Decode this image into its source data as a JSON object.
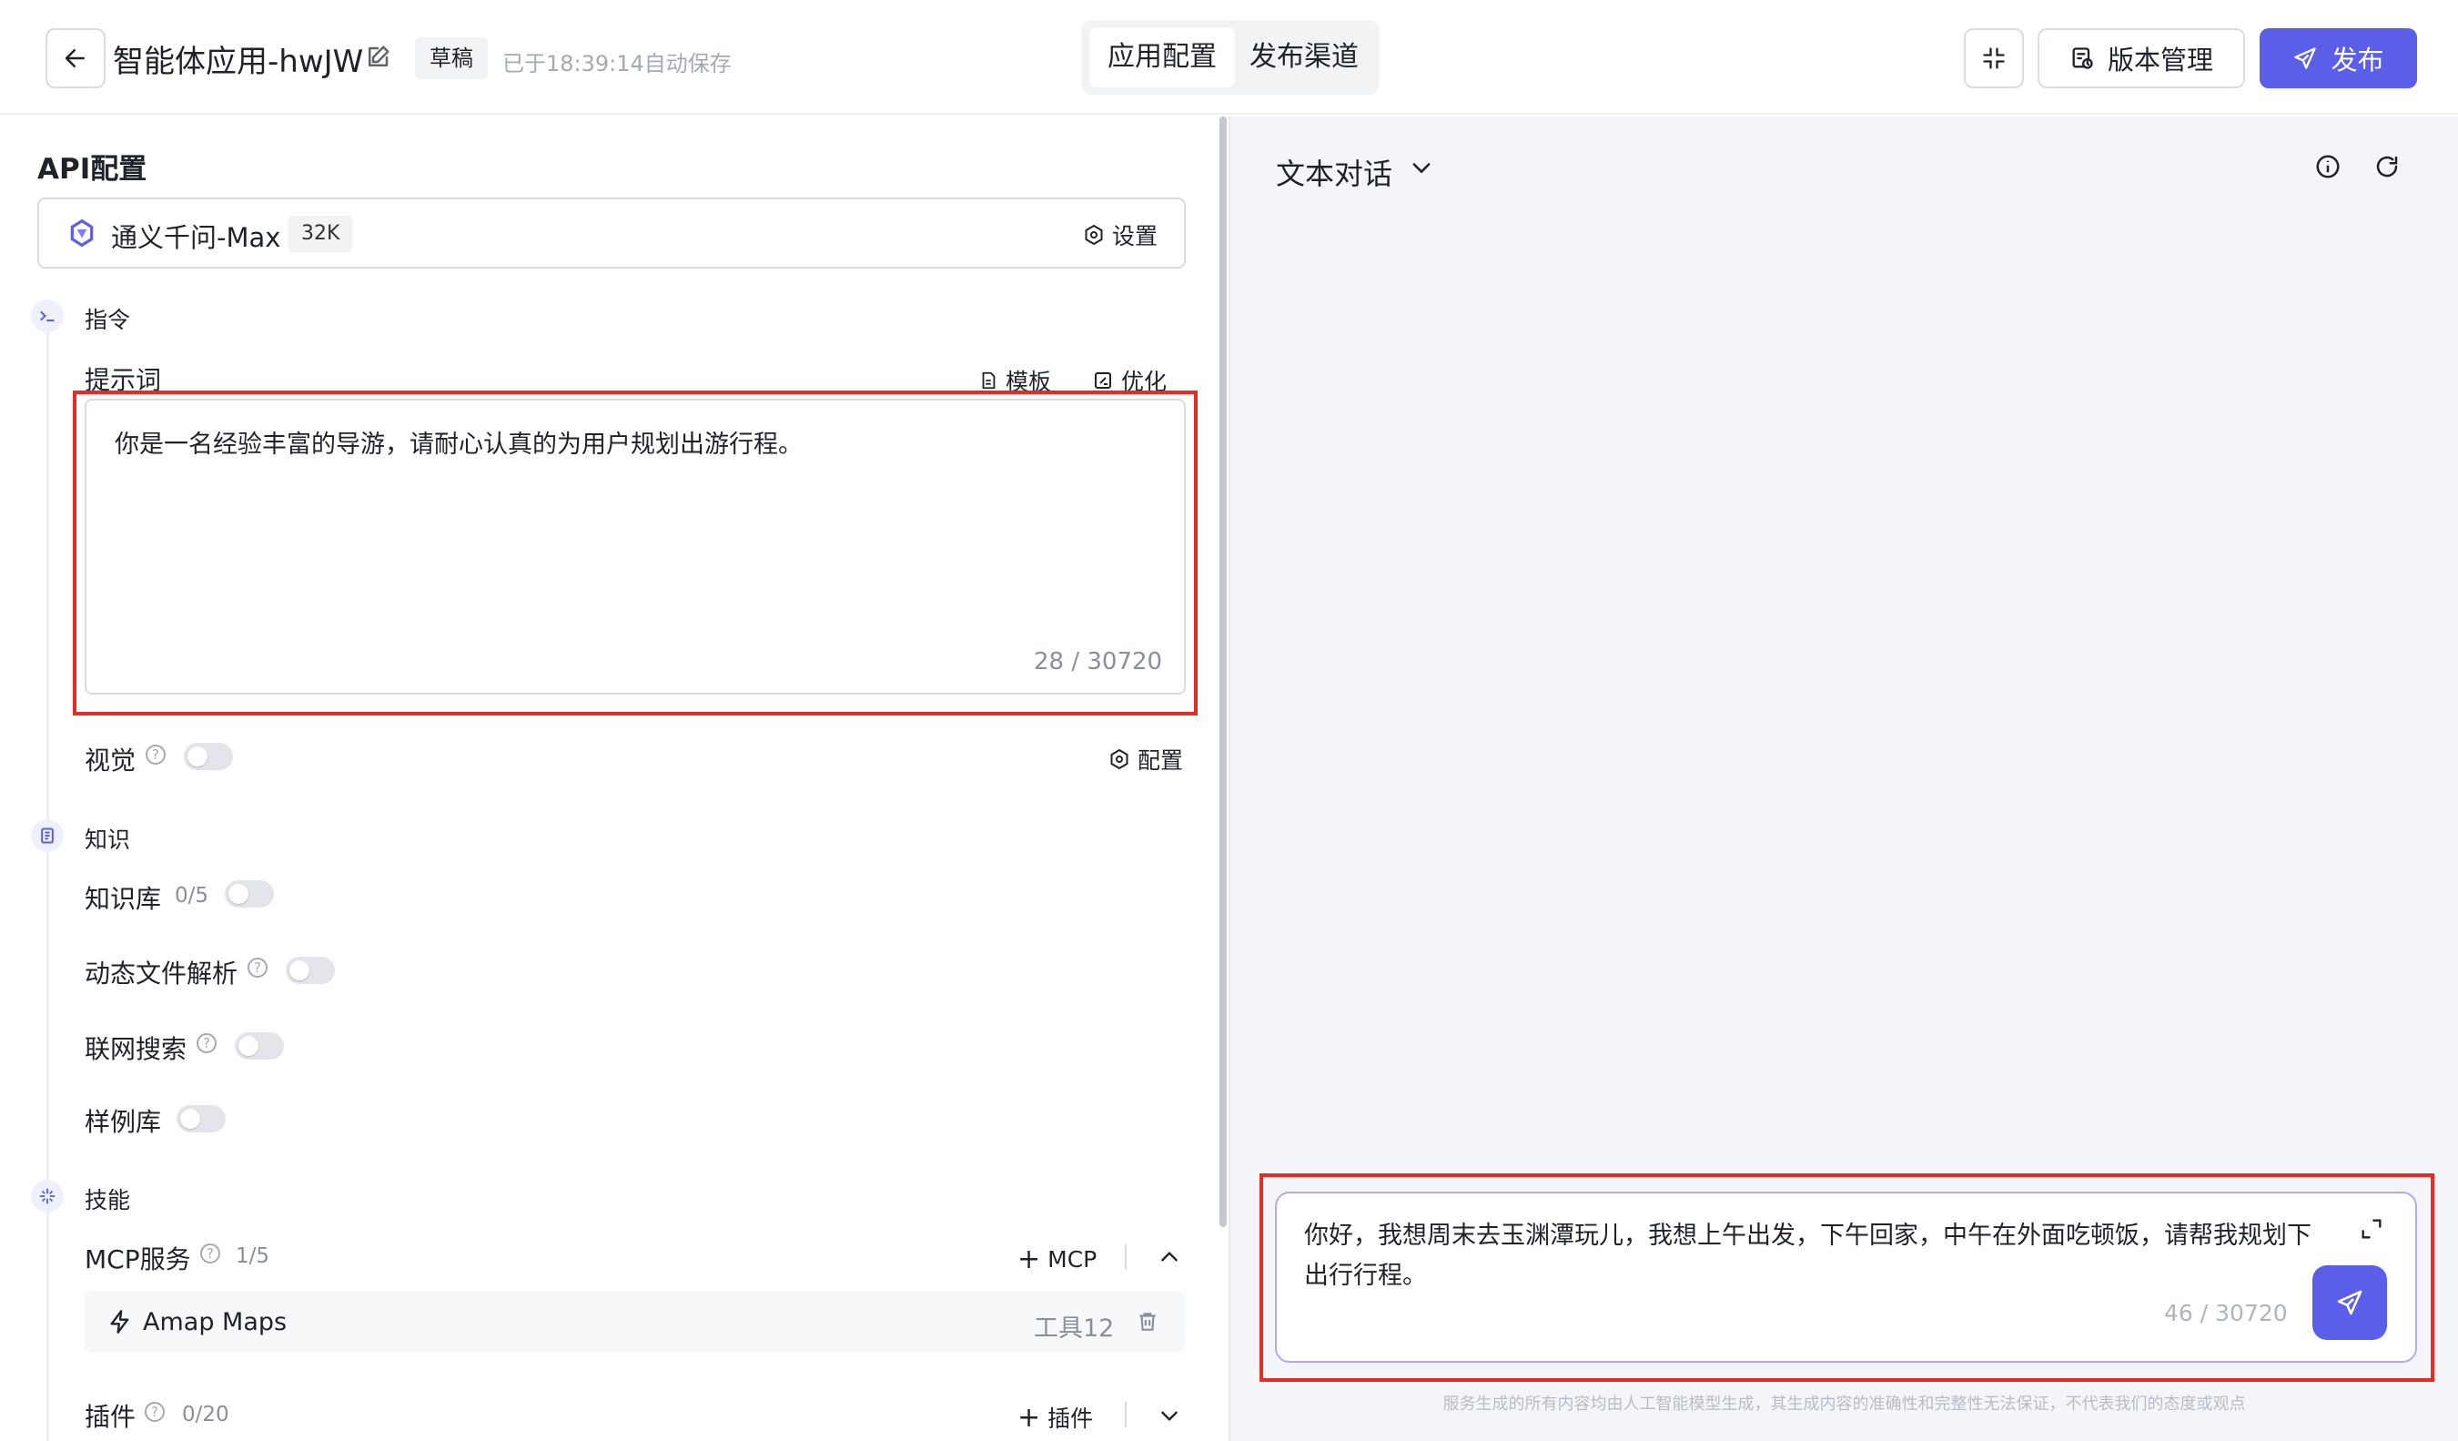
{
  "header": {
    "app_title": "智能体应用-hwJW",
    "draft_label": "草稿",
    "autosave_text": "已于18:39:14自动保存",
    "tabs": [
      {
        "label": "应用配置",
        "active": true
      },
      {
        "label": "发布渠道",
        "active": false
      }
    ],
    "version_label": "版本管理",
    "publish_label": "发布"
  },
  "left": {
    "section_title": "API配置",
    "model": {
      "name": "通义千问-Max",
      "context": "32K",
      "settings_label": "设置"
    },
    "instruction": {
      "group_label": "指令",
      "prompt_label": "提示词",
      "template_label": "模板",
      "optimize_label": "优化",
      "prompt_text": "你是一名经验丰富的导游，请耐心认真的为用户规划出游行程。",
      "prompt_count": "28 / 30720"
    },
    "vision": {
      "label": "视觉",
      "config_label": "配置",
      "enabled": false
    },
    "knowledge": {
      "group_label": "知识",
      "kb_label": "知识库",
      "kb_count": "0/5",
      "dynamic_label": "动态文件解析",
      "search_label": "联网搜索",
      "samples_label": "样例库"
    },
    "skills": {
      "group_label": "技能",
      "mcp_label": "MCP服务",
      "mcp_count": "1/5",
      "mcp_add": "MCP",
      "amap_name": "Amap Maps",
      "amap_tools": "工具12",
      "plugin_label": "插件",
      "plugin_count": "0/20",
      "plugin_add": "插件"
    }
  },
  "right": {
    "mode_label": "文本对话",
    "chat_input_value": "你好，我想周末去玉渊潭玩儿，我想上午出发，下午回家，中午在外面吃顿饭，请帮我规划下出行行程。",
    "chat_count": "46 / 30720",
    "disclaimer": "服务生成的所有内容均由人工智能模型生成，其生成内容的准确性和完整性无法保证，不代表我们的态度或观点"
  },
  "colors": {
    "accent": "#5b5ee8",
    "highlight": "#e62a24"
  }
}
